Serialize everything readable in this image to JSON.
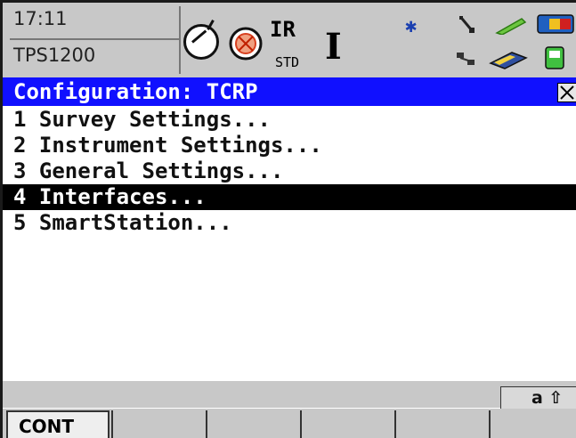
{
  "status": {
    "time": "17:11",
    "instrument": "TPS1200",
    "measure_mode": "IR",
    "measure_program": "STD",
    "cursor_symbol": "I",
    "icons": [
      "compass-prism-icon",
      "target-icon",
      "bluetooth-icon",
      "interface-link-icon",
      "battery-icon",
      "cf-card-icon",
      "level-icon"
    ]
  },
  "title": {
    "text": "Configuration: TCRP",
    "close_label": "X"
  },
  "menu": {
    "items": [
      {
        "label": "1 Survey Settings..."
      },
      {
        "label": "2 Instrument Settings..."
      },
      {
        "label": "3 General Settings..."
      },
      {
        "label": "4 Interfaces...",
        "selected": true
      },
      {
        "label": "5 SmartStation..."
      }
    ]
  },
  "mode_indicator": "a ⇧",
  "softkeys": [
    "CONT",
    "",
    "",
    "",
    "",
    ""
  ],
  "colors": {
    "title_bar": "#1010ff",
    "panel_gray": "#c8c8c8",
    "selected_row": "#000000"
  }
}
